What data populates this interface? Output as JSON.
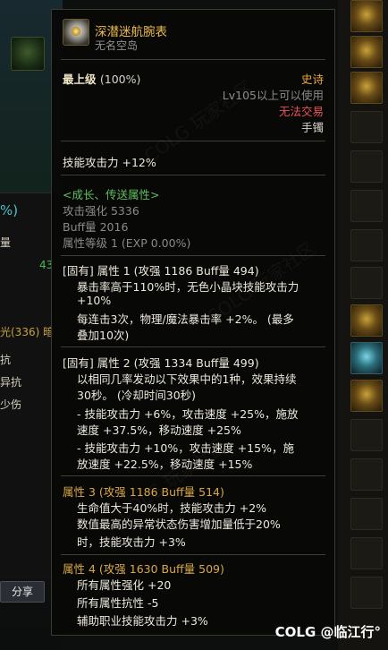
{
  "item": {
    "name": "深潜迷航腕表",
    "subtitle": "无名空岛",
    "grade_label": "最上级",
    "grade_percent": "(100%)",
    "rarity": "史诗",
    "level_req": "Lv105以上可以使用",
    "trade_status": "无法交易",
    "slot": "手镯",
    "base_stat": "技能攻击力  +12%",
    "growth_header": "<成长、传送属性>",
    "atk_enhance": "攻击强化 5336",
    "buff_amount": "Buff量 2016",
    "attr_level": "属性等级 1 (EXP 0.00%)"
  },
  "attributes": [
    {
      "title": "[固有] 属性 1 (攻强 1186    Buff量 494)",
      "lines": [
        "暴击率高于110%时，无色小晶块技能攻击力",
        "+10%",
        "每连击3次，物理/魔法暴击率 +2%。 (最多",
        "叠加10次)"
      ]
    },
    {
      "title": "[固有] 属性 2 (攻强 1334    Buff量 499)",
      "lines": [
        "以相同几率发动以下效果中的1种，效果持续",
        "30秒。 (冷却时间30秒)",
        "- 技能攻击力 +6%，攻击速度 +25%，施放",
        "速度 +37.5%，移动速度 +25%",
        "- 技能攻击力 +10%，攻击速度 +15%，施",
        "放速度 +22.5%，移动速度 +15%"
      ]
    },
    {
      "title": "属性 3 (攻强 1186    Buff量 514)",
      "lines": [
        "生命值大于40%时，技能攻击力 +2%",
        "数值最高的异常状态伤害增加量低于20%",
        "时，技能攻击力 +3%"
      ]
    },
    {
      "title": "属性 4 (攻强 1630    Buff量 509)",
      "lines": [
        "所有属性强化 +20",
        "所有属性抗性 -5",
        "辅助职业技能攻击力 +3%"
      ]
    }
  ],
  "background": {
    "frag_percent": "%)",
    "frag_quantity": "量",
    "frag_number": "43",
    "frag_light": "光(336) 暗",
    "frag_resist": "抗",
    "frag_abn_resist": "异抗",
    "frag_abn_dmg": "少伤",
    "share_button": "分享"
  },
  "watermark": {
    "brand": "COLG @临江行°",
    "site_text": "COLG 玩家社区"
  },
  "colors": {
    "epic": "#e7a73c",
    "untradable": "#e85454",
    "growth": "#5fc05f",
    "item_name": "#eab94d",
    "attr_title_gold": "#d8a849"
  }
}
